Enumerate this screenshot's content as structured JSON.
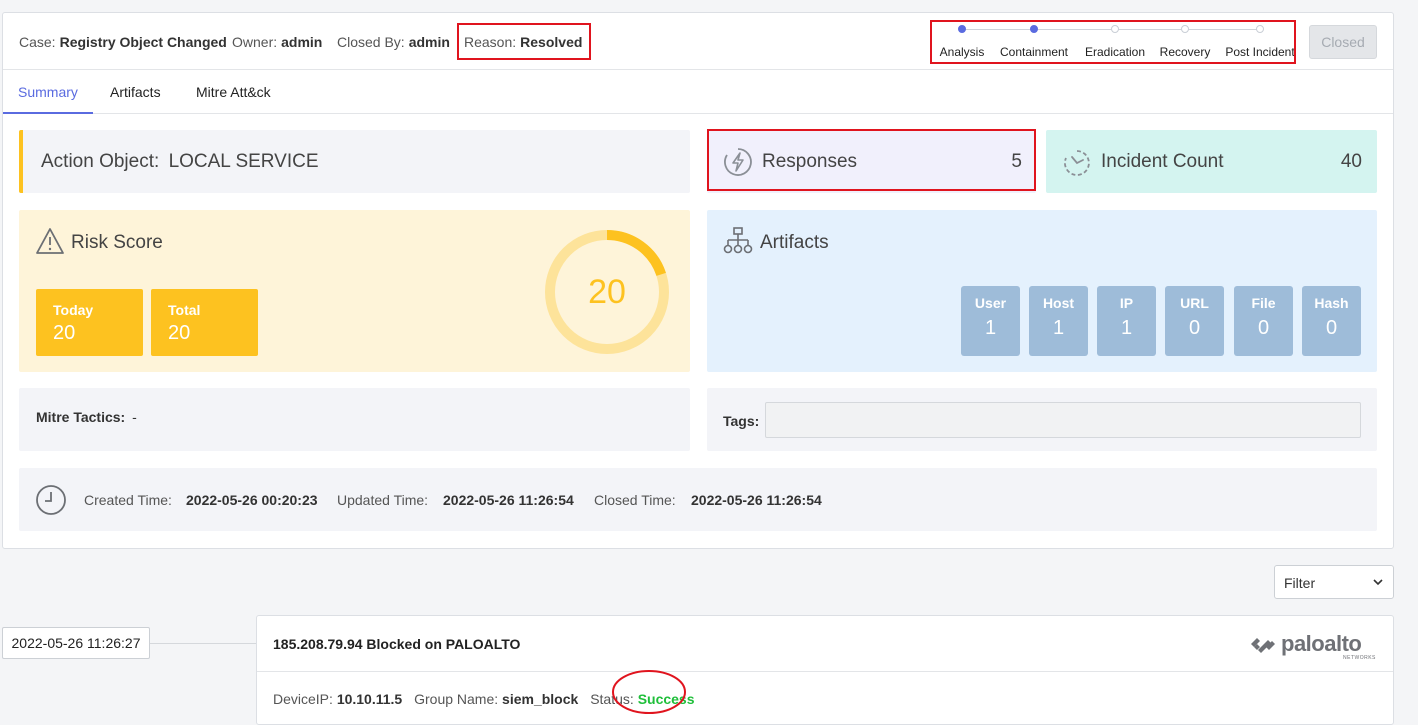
{
  "header": {
    "case_label": "Case:",
    "case_value": "Registry Object Changed",
    "owner_label": "Owner:",
    "owner_value": "admin",
    "closed_by_label": "Closed By:",
    "closed_by_value": "admin",
    "reason_label": "Reason:",
    "reason_value": "Resolved",
    "closed_button": "Closed"
  },
  "stepper": {
    "steps": [
      {
        "label": "Analysis",
        "done": true
      },
      {
        "label": "Containment",
        "done": true
      },
      {
        "label": "Eradication",
        "done": false
      },
      {
        "label": "Recovery",
        "done": false
      },
      {
        "label": "Post Incident",
        "done": false
      }
    ]
  },
  "tabs": [
    "Summary",
    "Artifacts",
    "Mitre Att&ck"
  ],
  "action_object": {
    "label": "Action Object:",
    "value": "LOCAL SERVICE"
  },
  "responses": {
    "label": "Responses",
    "value": "5"
  },
  "incident_count": {
    "label": "Incident Count",
    "value": "40"
  },
  "risk": {
    "title": "Risk Score",
    "today_label": "Today",
    "today_value": "20",
    "total_label": "Total",
    "total_value": "20",
    "score": "20",
    "score_fraction": 0.2
  },
  "artifacts": {
    "title": "Artifacts",
    "tiles": [
      {
        "label": "User",
        "value": "1"
      },
      {
        "label": "Host",
        "value": "1"
      },
      {
        "label": "IP",
        "value": "1"
      },
      {
        "label": "URL",
        "value": "0"
      },
      {
        "label": "File",
        "value": "0"
      },
      {
        "label": "Hash",
        "value": "0"
      }
    ]
  },
  "mitre": {
    "label": "Mitre Tactics:",
    "value": "-"
  },
  "tags": {
    "label": "Tags:"
  },
  "times": {
    "created_label": "Created Time:",
    "created_value": "2022-05-26 00:20:23",
    "updated_label": "Updated Time:",
    "updated_value": "2022-05-26 11:26:54",
    "closed_label": "Closed Time:",
    "closed_value": "2022-05-26 11:26:54"
  },
  "filter": {
    "label": "Filter"
  },
  "timeline": {
    "timestamp": "2022-05-26 11:26:27",
    "title": "185.208.79.94 Blocked on PALOALTO",
    "vendor": "paloalto",
    "vendor_sub": "NETWORKS",
    "device_ip_label": "DeviceIP:",
    "device_ip_value": "10.10.11.5",
    "group_label": "Group Name:",
    "group_value": "siem_block",
    "status_label": "Status:",
    "status_value": "Success"
  },
  "colors": {
    "accent": "#5a6be0",
    "yellow": "#fdc220",
    "highlight": "#e0141e",
    "success": "#1fbf3a"
  }
}
